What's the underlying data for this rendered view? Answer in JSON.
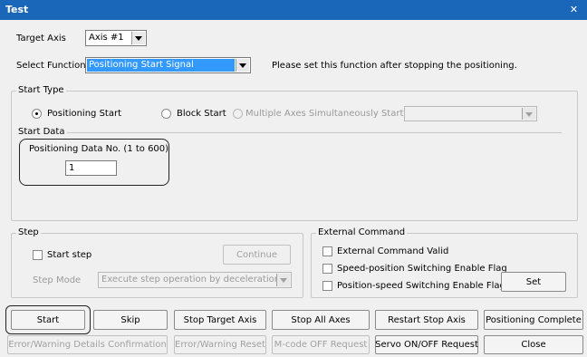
{
  "window": {
    "title": "Test",
    "close_glyph": "✕"
  },
  "target_axis": {
    "label": "Target Axis",
    "value": "Axis #1"
  },
  "select_function": {
    "label": "Select Function",
    "value": "Positioning Start Signal",
    "note": "Please set this function after stopping the positioning."
  },
  "start_type": {
    "group_label": "Start Type",
    "positioning_start": "Positioning Start",
    "block_start": "Block Start",
    "multi_axes": "Multiple Axes Simultaneously Start :",
    "multi_axes_value": "",
    "selected": "positioning_start"
  },
  "start_data": {
    "label": "Start Data",
    "field_label": "Positioning Data No. (1 to 600)",
    "field_value": "1"
  },
  "step": {
    "group_label": "Step",
    "start_step": "Start step",
    "continue": "Continue",
    "mode_label": "Step Mode",
    "mode_value": "Execute step operation by deceleration"
  },
  "external_command": {
    "group_label": "External Command",
    "valid": "External Command Valid",
    "speed_position": "Speed-position Switching Enable Flag",
    "position_speed": "Position-speed Switching Enable Flag",
    "set": "Set"
  },
  "buttons_row1": {
    "start": "Start",
    "skip": "Skip",
    "stop_target_axis": "Stop Target Axis",
    "stop_all_axes": "Stop All Axes",
    "restart_stop_axis": "Restart Stop Axis",
    "positioning_complete": "Positioning Complete"
  },
  "buttons_row2": {
    "error_details": "Error/Warning Details Confirmation",
    "error_reset": "Error/Warning Reset",
    "mcode_off": "M-code OFF Request",
    "servo_onoff": "Servo ON/OFF Request",
    "close": "Close"
  }
}
